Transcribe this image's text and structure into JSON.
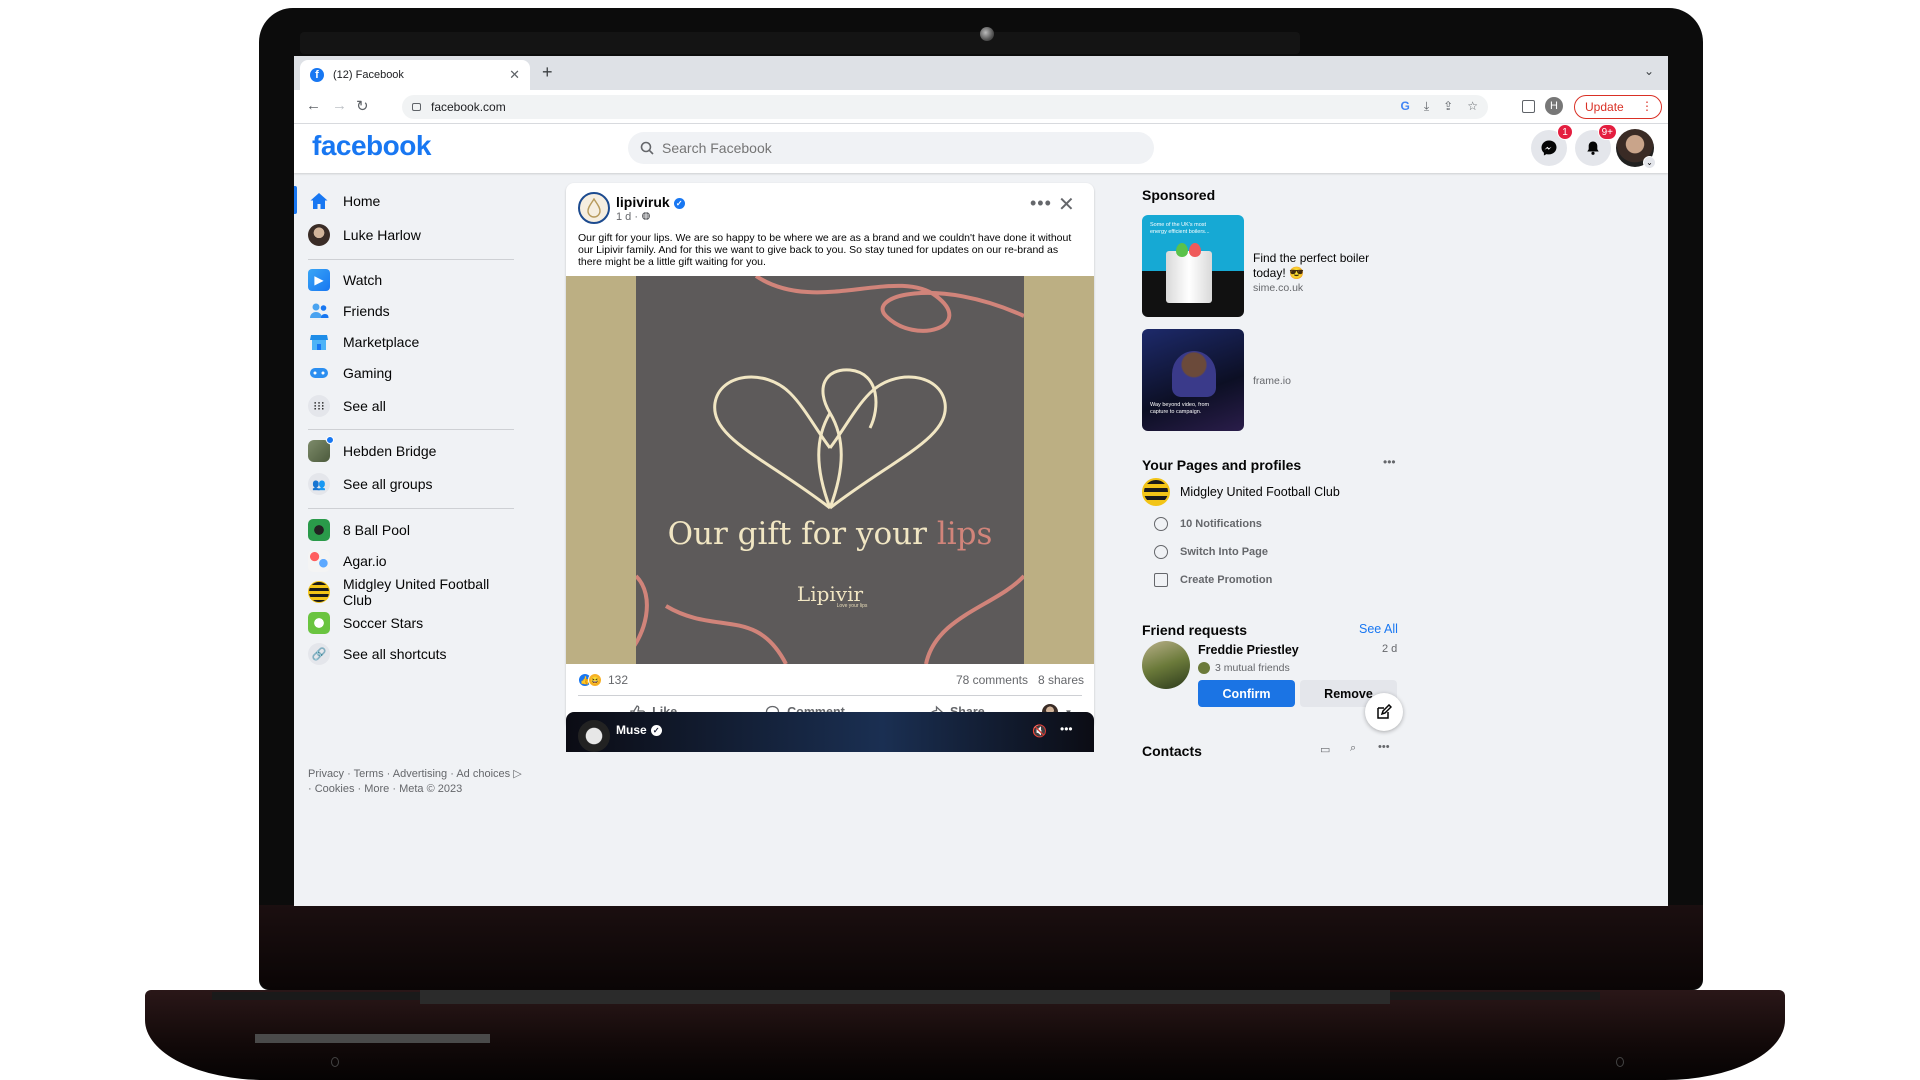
{
  "browser": {
    "tab_title": "(12) Facebook",
    "url": "facebook.com",
    "update_label": "Update"
  },
  "header": {
    "logo": "facebook",
    "search_placeholder": "Search Facebook",
    "messenger_badge": "1",
    "notifications_badge": "9+"
  },
  "left_nav": {
    "primary": [
      {
        "label": "Home",
        "icon": "home-icon"
      },
      {
        "label": "Luke Harlow",
        "icon": "avatar"
      }
    ],
    "menu": [
      {
        "label": "Watch",
        "icon": "watch-icon"
      },
      {
        "label": "Friends",
        "icon": "friends-icon"
      },
      {
        "label": "Marketplace",
        "icon": "marketplace-icon"
      },
      {
        "label": "Gaming",
        "icon": "gaming-icon"
      },
      {
        "label": "See all",
        "icon": "grid-icon"
      }
    ],
    "groups": [
      {
        "label": "Hebden Bridge",
        "icon": "group-icon"
      },
      {
        "label": "See all groups",
        "icon": "groups-icon"
      }
    ],
    "shortcuts": [
      {
        "label": "8 Ball Pool",
        "icon": "pool-icon"
      },
      {
        "label": "Agar.io",
        "icon": "agario-icon"
      },
      {
        "label": "Midgley United Football Club",
        "icon": "club-icon"
      },
      {
        "label": "Soccer Stars",
        "icon": "soccer-icon"
      },
      {
        "label": "See all shortcuts",
        "icon": "link-icon"
      }
    ],
    "footer_line1": "Privacy · Terms · Advertising · Ad choices ▷",
    "footer_line2": "· Cookies · More · Meta © 2023"
  },
  "post": {
    "author": "lipiviruk",
    "time": "1 d ·",
    "text": "Our gift for your lips. We are so happy to be where we are as a brand and we couldn't have done it without our Lipivir family. And for this we want to give back to you. So stay tuned for updates on our re-brand as there might be a little gift waiting for you.",
    "image_caption_main": "Our gift for your ",
    "image_caption_accent": "lips",
    "image_brand": "Lipivir",
    "image_tagline": "Love your lips",
    "reaction_count": "132",
    "comments": "78 comments",
    "shares": "8 shares",
    "actions": {
      "like": "Like",
      "comment": "Comment",
      "share": "Share"
    }
  },
  "next_post": {
    "author": "Muse"
  },
  "right_rail": {
    "sponsored_heading": "Sponsored",
    "ads": [
      {
        "title": "Find the perfect boiler today! 😎",
        "domain": "sime.co.uk",
        "thumb_text": "Some of the UK's most energy efficient boilers..."
      },
      {
        "title": "",
        "domain": "frame.io",
        "thumb_text": "Way beyond video, from capture to campaign."
      }
    ],
    "pages_heading": "Your Pages and profiles",
    "page_name": "Midgley United Football Club",
    "page_actions": [
      "10 Notifications",
      "Switch Into Page",
      "Create Promotion"
    ],
    "friend_requests_heading": "Friend requests",
    "see_all": "See All",
    "friend": {
      "name": "Freddie Priestley",
      "time": "2 d",
      "mutual": "3 mutual friends"
    },
    "confirm": "Confirm",
    "remove": "Remove",
    "contacts_heading": "Contacts"
  }
}
